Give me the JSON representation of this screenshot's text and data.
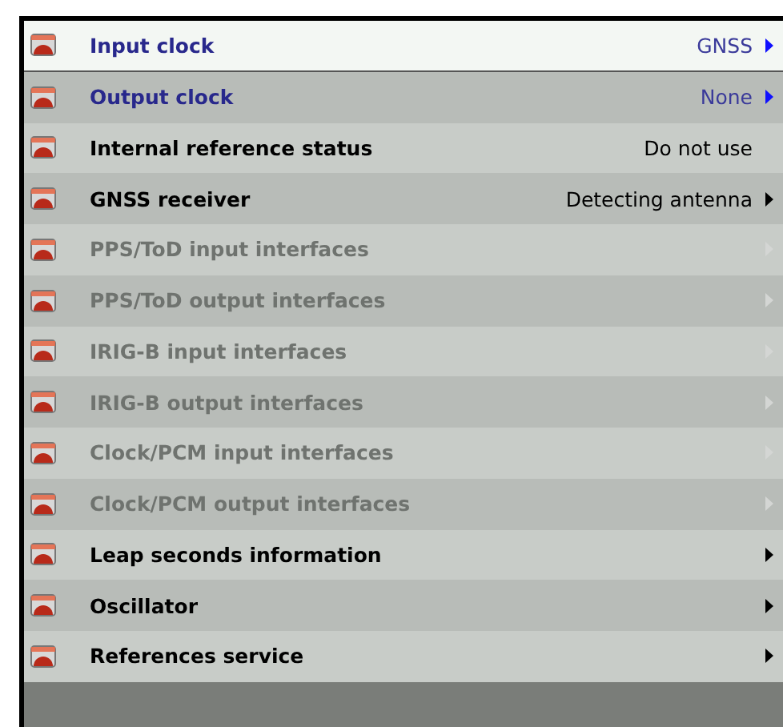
{
  "menu": [
    {
      "label": "Input clock",
      "value": "GNSS",
      "selected": true,
      "emphasized": true,
      "disabled": false,
      "submenu": true
    },
    {
      "label": "Output clock",
      "value": "None",
      "selected": false,
      "emphasized": true,
      "disabled": false,
      "submenu": true
    },
    {
      "label": "Internal reference status",
      "value": "Do not use",
      "selected": false,
      "emphasized": false,
      "disabled": false,
      "submenu": false
    },
    {
      "label": "GNSS receiver",
      "value": "Detecting antenna",
      "selected": false,
      "emphasized": false,
      "disabled": false,
      "submenu": true
    },
    {
      "label": "PPS/ToD input interfaces",
      "selected": false,
      "emphasized": false,
      "disabled": true,
      "submenu": true
    },
    {
      "label": "PPS/ToD output interfaces",
      "selected": false,
      "emphasized": false,
      "disabled": true,
      "submenu": true
    },
    {
      "label": "IRIG-B input interfaces",
      "selected": false,
      "emphasized": false,
      "disabled": true,
      "submenu": true
    },
    {
      "label": "IRIG-B output interfaces",
      "selected": false,
      "emphasized": false,
      "disabled": true,
      "submenu": true
    },
    {
      "label": "Clock/PCM input interfaces",
      "selected": false,
      "emphasized": false,
      "disabled": true,
      "submenu": true
    },
    {
      "label": "Clock/PCM output interfaces",
      "selected": false,
      "emphasized": false,
      "disabled": true,
      "submenu": true
    },
    {
      "label": "Leap seconds information",
      "selected": false,
      "emphasized": false,
      "disabled": false,
      "submenu": true
    },
    {
      "label": "Oscillator",
      "selected": false,
      "emphasized": false,
      "disabled": false,
      "submenu": true
    },
    {
      "label": "References service",
      "selected": false,
      "emphasized": false,
      "disabled": false,
      "submenu": true
    }
  ]
}
